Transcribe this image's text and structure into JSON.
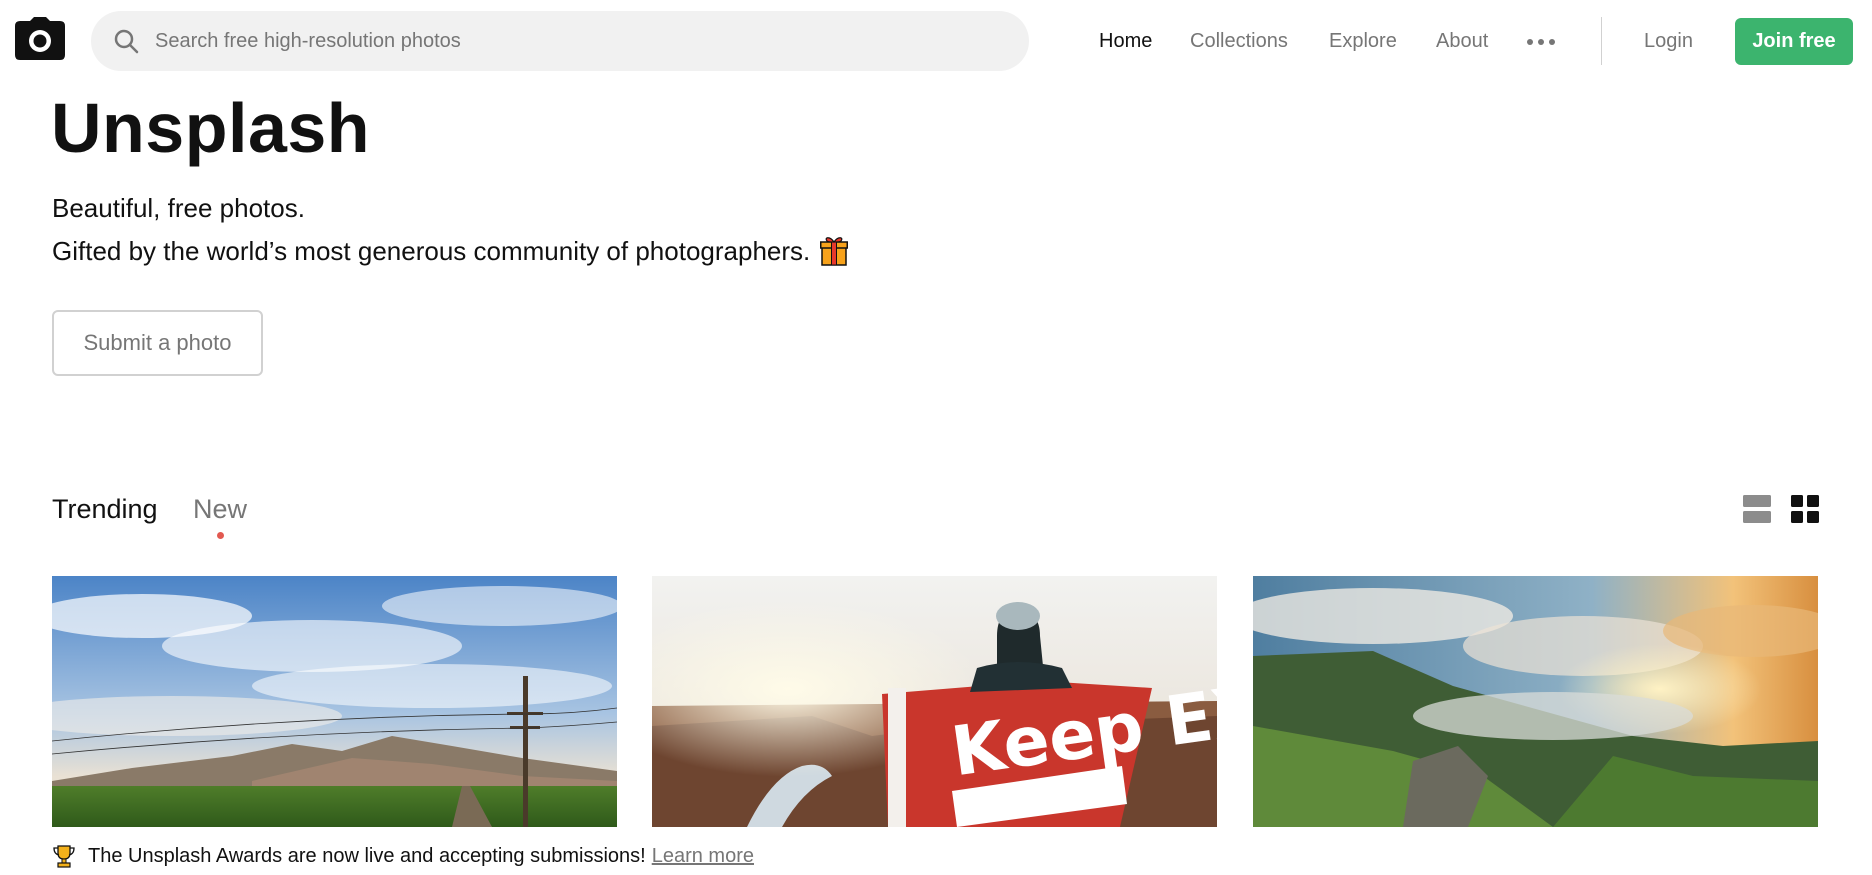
{
  "header": {
    "logo_icon": "camera-icon",
    "search": {
      "placeholder": "Search free high-resolution photos",
      "value": "",
      "icon": "search-icon"
    },
    "nav": [
      {
        "label": "Home",
        "active": true
      },
      {
        "label": "Collections",
        "active": false
      },
      {
        "label": "Explore",
        "active": false
      },
      {
        "label": "About",
        "active": false
      }
    ],
    "more_icon": "more-horizontal-icon",
    "login_label": "Login",
    "join_label": "Join free"
  },
  "hero": {
    "title": "Unsplash",
    "line1": "Beautiful, free photos.",
    "line2": "Gifted by the world’s most generous community of photographers.",
    "line2_icon": "gift-icon",
    "submit_label": "Submit a photo"
  },
  "feed": {
    "tabs": [
      {
        "label": "Trending",
        "active": true
      },
      {
        "label": "New",
        "active": false
      }
    ],
    "view_icons": [
      "list-view-icon",
      "grid-view-icon"
    ],
    "selected_view": "grid",
    "photos": [
      {
        "subject": "farm-field-power-pole-photo",
        "overlay_text": ""
      },
      {
        "subject": "person-holding-flag-canyon-photo",
        "overlay_text": "Keep EXPLORING"
      },
      {
        "subject": "green-cliffs-sunset-photo",
        "overlay_text": ""
      }
    ]
  },
  "notice": {
    "icon": "trophy-icon",
    "text": "The Unsplash Awards are now live and accepting submissions!",
    "link_label": "Learn more"
  },
  "colors": {
    "brand_green": "#3cb46e",
    "muted_text": "#767676",
    "search_bg": "#f1f1f1",
    "new_tab_dot": "#e25950"
  }
}
